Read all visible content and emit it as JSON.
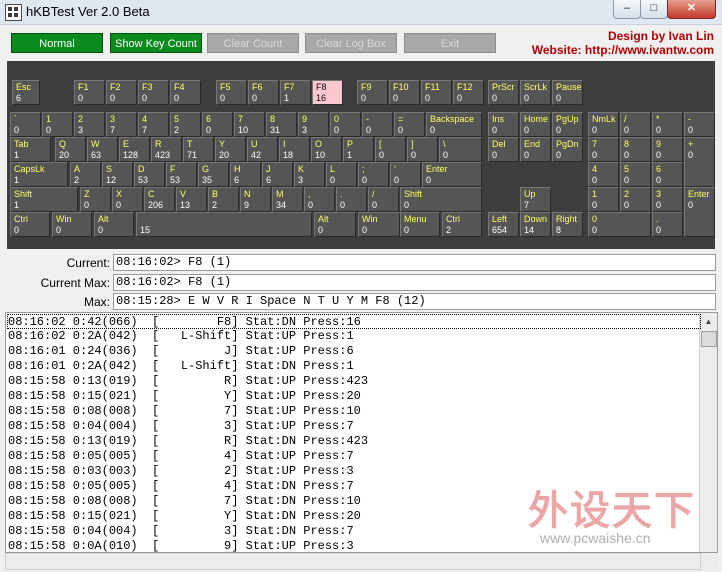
{
  "window": {
    "title": "hKBTest Ver 2.0 Beta",
    "minimize": "–",
    "maximize": "□",
    "close": "✕"
  },
  "toolbar": {
    "buttons": [
      {
        "label": "Normal",
        "state": "active"
      },
      {
        "label": "Show Key Count",
        "state": "active"
      },
      {
        "label": "Clear Count",
        "state": "disabled"
      },
      {
        "label": "Clear Log Box",
        "state": "disabled"
      },
      {
        "label": "Exit",
        "state": "disabled"
      }
    ],
    "credit_line1": "Design by Ivan Lin",
    "credit_line2": "Website: http://www.ivantw.com"
  },
  "keys": [
    {
      "label": "Esc",
      "count": "6"
    },
    {
      "label": "F1",
      "count": "0"
    },
    {
      "label": "F2",
      "count": "0"
    },
    {
      "label": "F3",
      "count": "0"
    },
    {
      "label": "F4",
      "count": "0"
    },
    {
      "label": "F5",
      "count": "0"
    },
    {
      "label": "F6",
      "count": "0"
    },
    {
      "label": "F7",
      "count": "1"
    },
    {
      "label": "F8",
      "count": "16",
      "pressed": true
    },
    {
      "label": "F9",
      "count": "0"
    },
    {
      "label": "F10",
      "count": "0"
    },
    {
      "label": "F11",
      "count": "0"
    },
    {
      "label": "F12",
      "count": "0"
    },
    {
      "label": "PrScr",
      "count": "0"
    },
    {
      "label": "ScrLk",
      "count": "0"
    },
    {
      "label": "Pause",
      "count": "0"
    },
    {
      "label": "`",
      "count": "0"
    },
    {
      "label": "1",
      "count": "0"
    },
    {
      "label": "2",
      "count": "3"
    },
    {
      "label": "3",
      "count": "7"
    },
    {
      "label": "4",
      "count": "7"
    },
    {
      "label": "5",
      "count": "2"
    },
    {
      "label": "6",
      "count": "0"
    },
    {
      "label": "7",
      "count": "10"
    },
    {
      "label": "8",
      "count": "31"
    },
    {
      "label": "9",
      "count": "3"
    },
    {
      "label": "0",
      "count": "0"
    },
    {
      "label": "-",
      "count": "0"
    },
    {
      "label": "=",
      "count": "0"
    },
    {
      "label": "Backspace",
      "count": "0"
    },
    {
      "label": "Ins",
      "count": "0"
    },
    {
      "label": "Home",
      "count": "0"
    },
    {
      "label": "PgUp",
      "count": "0"
    },
    {
      "label": "NmLk",
      "count": "0"
    },
    {
      "label": "/",
      "count": "0"
    },
    {
      "label": "*",
      "count": "0"
    },
    {
      "label": "-",
      "count": "0"
    },
    {
      "label": "Tab",
      "count": "1"
    },
    {
      "label": "Q",
      "count": "20"
    },
    {
      "label": "W",
      "count": "63"
    },
    {
      "label": "E",
      "count": "128"
    },
    {
      "label": "R",
      "count": "423"
    },
    {
      "label": "T",
      "count": "71"
    },
    {
      "label": "Y",
      "count": "20"
    },
    {
      "label": "U",
      "count": "42"
    },
    {
      "label": "I",
      "count": "18"
    },
    {
      "label": "O",
      "count": "10"
    },
    {
      "label": "P",
      "count": "1"
    },
    {
      "label": "[",
      "count": "0"
    },
    {
      "label": "]",
      "count": "0"
    },
    {
      "label": "\\",
      "count": "0"
    },
    {
      "label": "Del",
      "count": "0"
    },
    {
      "label": "End",
      "count": "0"
    },
    {
      "label": "PgDn",
      "count": "0"
    },
    {
      "label": "7",
      "count": "0"
    },
    {
      "label": "8",
      "count": "0"
    },
    {
      "label": "9",
      "count": "0"
    },
    {
      "label": "+",
      "count": "0"
    },
    {
      "label": "CapsLk",
      "count": "1"
    },
    {
      "label": "A",
      "count": "2"
    },
    {
      "label": "S",
      "count": "12"
    },
    {
      "label": "D",
      "count": "53"
    },
    {
      "label": "F",
      "count": "53"
    },
    {
      "label": "G",
      "count": "35"
    },
    {
      "label": "H",
      "count": "6"
    },
    {
      "label": "J",
      "count": "6"
    },
    {
      "label": "K",
      "count": "3"
    },
    {
      "label": "L",
      "count": "0"
    },
    {
      "label": ";",
      "count": "0"
    },
    {
      "label": "'",
      "count": "0"
    },
    {
      "label": "Enter",
      "count": "0"
    },
    {
      "label": "4",
      "count": "0"
    },
    {
      "label": "5",
      "count": "0"
    },
    {
      "label": "6",
      "count": "0"
    },
    {
      "label": "Shift",
      "count": "1"
    },
    {
      "label": "Z",
      "count": "0"
    },
    {
      "label": "X",
      "count": "0"
    },
    {
      "label": "C",
      "count": "206"
    },
    {
      "label": "V",
      "count": "13"
    },
    {
      "label": "B",
      "count": "2"
    },
    {
      "label": "N",
      "count": "9"
    },
    {
      "label": "M",
      "count": "34"
    },
    {
      "label": ",",
      "count": "0"
    },
    {
      "label": ".",
      "count": "0"
    },
    {
      "label": "/",
      "count": "0"
    },
    {
      "label": "Shift",
      "count": "0"
    },
    {
      "label": "Up",
      "count": "7"
    },
    {
      "label": "1",
      "count": "0"
    },
    {
      "label": "2",
      "count": "0"
    },
    {
      "label": "3",
      "count": "0"
    },
    {
      "label": "Enter",
      "count": "0"
    },
    {
      "label": "Ctrl",
      "count": "0"
    },
    {
      "label": "Win",
      "count": "0"
    },
    {
      "label": "Alt",
      "count": "0"
    },
    {
      "label": "",
      "count": "15"
    },
    {
      "label": "Alt",
      "count": "0"
    },
    {
      "label": "Win",
      "count": "0"
    },
    {
      "label": "Menu",
      "count": "0"
    },
    {
      "label": "Ctrl",
      "count": "2"
    },
    {
      "label": "Left",
      "count": "654"
    },
    {
      "label": "Down",
      "count": "14"
    },
    {
      "label": "Right",
      "count": "8"
    },
    {
      "label": "0",
      "count": "0"
    },
    {
      "label": ".",
      "count": "0"
    }
  ],
  "status": {
    "current_label": "Current:",
    "current_value": "08:16:02> F8 (1)",
    "current_max_label": "Current Max:",
    "current_max_value": "08:16:02> F8 (1)",
    "max_label": "Max:",
    "max_value": "08:15:28> E W V R I Space N T U Y M F8 (12)"
  },
  "log": [
    "08:16:02 0:42(066)  [        F8] Stat:DN Press:16",
    "08:16:02 0:2A(042)  [   L-Shift] Stat:UP Press:1",
    "08:16:01 0:24(036)  [         J] Stat:UP Press:6",
    "08:16:01 0:2A(042)  [   L-Shift] Stat:DN Press:1",
    "08:15:58 0:13(019)  [         R] Stat:UP Press:423",
    "08:15:58 0:15(021)  [         Y] Stat:UP Press:20",
    "08:15:58 0:08(008)  [         7] Stat:UP Press:10",
    "08:15:58 0:04(004)  [         3] Stat:UP Press:7",
    "08:15:58 0:13(019)  [         R] Stat:DN Press:423",
    "08:15:58 0:05(005)  [         4] Stat:UP Press:7",
    "08:15:58 0:03(003)  [         2] Stat:UP Press:3",
    "08:15:58 0:05(005)  [         4] Stat:DN Press:7",
    "08:15:58 0:08(008)  [         7] Stat:DN Press:10",
    "08:15:58 0:15(021)  [         Y] Stat:DN Press:20",
    "08:15:58 0:04(004)  [         3] Stat:DN Press:7",
    "08:15:58 0:0A(010)  [         9] Stat:UP Press:3"
  ],
  "watermark": {
    "big": "外设天下",
    "small": "www.pcwaishe.cn"
  }
}
